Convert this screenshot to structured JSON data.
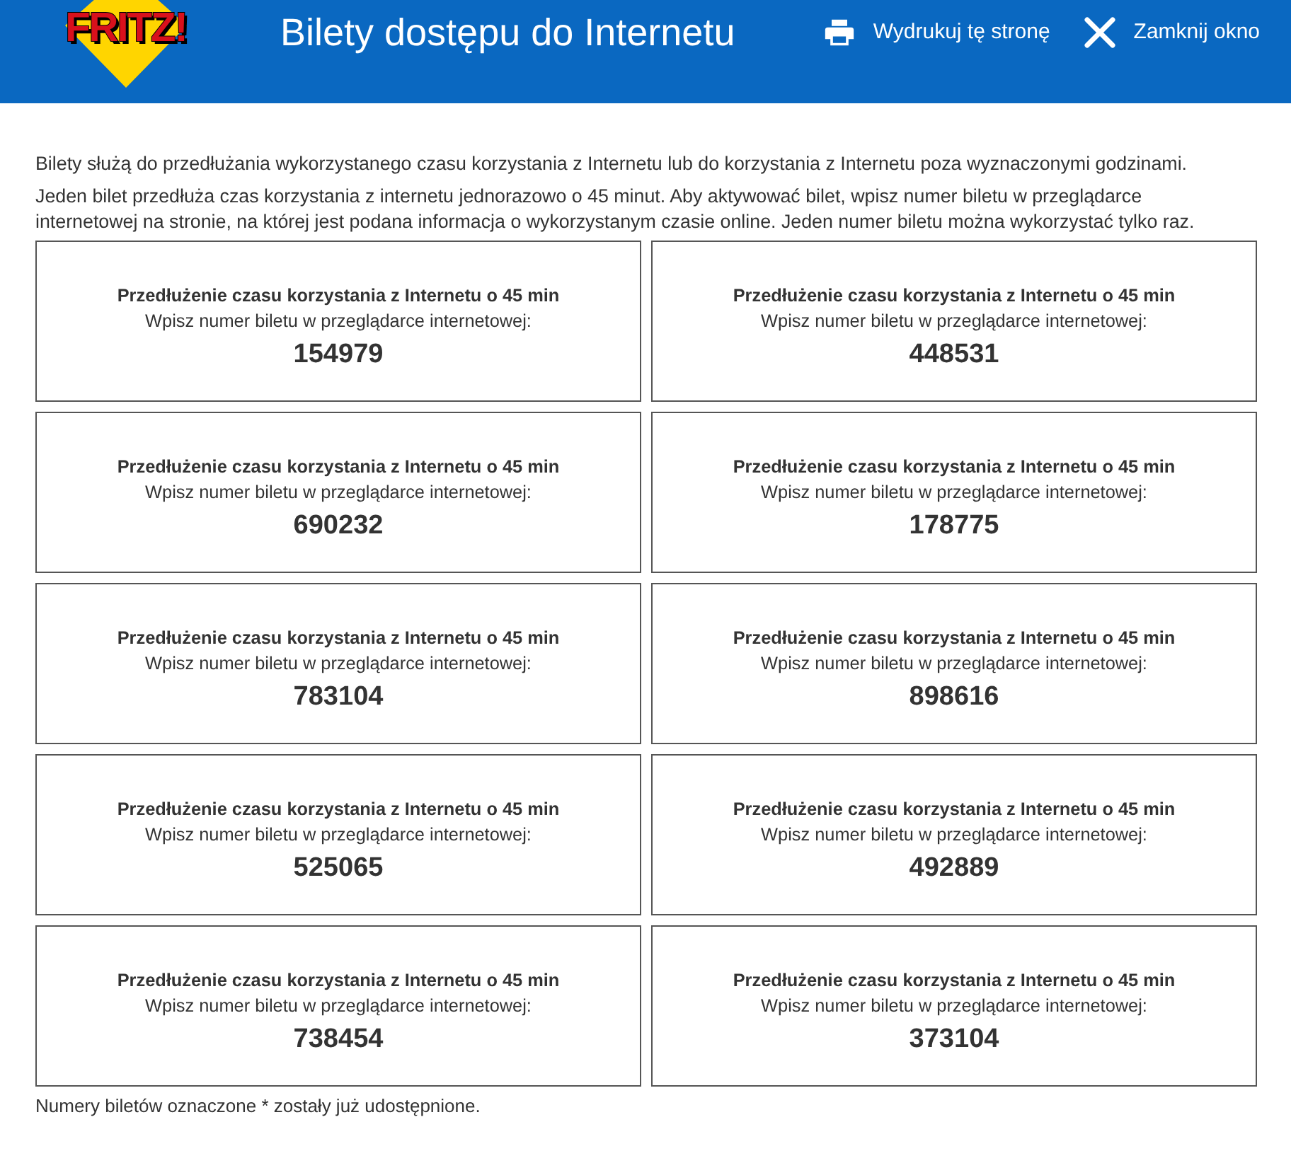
{
  "header": {
    "logo": "FRITZ!",
    "title": "Bilety dostępu do Internetu",
    "actions": [
      {
        "kind": "print",
        "label": "Wydrukuj tę stronę"
      },
      {
        "kind": "close",
        "label": "Zamknij okno"
      }
    ]
  },
  "intro": [
    "Bilety służą do przedłużania wykorzystanego czasu korzystania z Internetu lub do korzystania z Internetu poza wyznaczonymi godzinami.",
    "Jeden bilet przedłuża czas korzystania z internetu jednorazowo o 45 minut. Aby aktywować bilet, wpisz numer biletu w przeglądarce internetowej na stronie, na której jest podana informacja o wykorzystanym czasie online. Jeden numer biletu można wykorzystać tylko raz."
  ],
  "tickets": [
    {
      "title": "Przedłużenie czasu korzystania z Internetu o 45 min",
      "instruction": "Wpisz numer biletu w przeglądarce internetowej:",
      "number": "154979"
    },
    {
      "title": "Przedłużenie czasu korzystania z Internetu o 45 min",
      "instruction": "Wpisz numer biletu w przeglądarce internetowej:",
      "number": "448531"
    },
    {
      "title": "Przedłużenie czasu korzystania z Internetu o 45 min",
      "instruction": "Wpisz numer biletu w przeglądarce internetowej:",
      "number": "690232"
    },
    {
      "title": "Przedłużenie czasu korzystania z Internetu o 45 min",
      "instruction": "Wpisz numer biletu w przeglądarce internetowej:",
      "number": "178775"
    },
    {
      "title": "Przedłużenie czasu korzystania z Internetu o 45 min",
      "instruction": "Wpisz numer biletu w przeglądarce internetowej:",
      "number": "783104"
    },
    {
      "title": "Przedłużenie czasu korzystania z Internetu o 45 min",
      "instruction": "Wpisz numer biletu w przeglądarce internetowej:",
      "number": "898616"
    },
    {
      "title": "Przedłużenie czasu korzystania z Internetu o 45 min",
      "instruction": "Wpisz numer biletu w przeglądarce internetowej:",
      "number": "525065"
    },
    {
      "title": "Przedłużenie czasu korzystania z Internetu o 45 min",
      "instruction": "Wpisz numer biletu w przeglądarce internetowej:",
      "number": "492889"
    },
    {
      "title": "Przedłużenie czasu korzystania z Internetu o 45 min",
      "instruction": "Wpisz numer biletu w przeglądarce internetowej:",
      "number": "738454"
    },
    {
      "title": "Przedłużenie czasu korzystania z Internetu o 45 min",
      "instruction": "Wpisz numer biletu w przeglądarce internetowej:",
      "number": "373104"
    }
  ],
  "footnote": "Numery biletów oznaczone * zostały już udostępnione."
}
